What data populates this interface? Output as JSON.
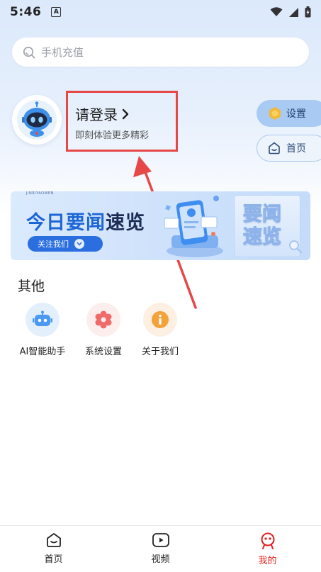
{
  "status_bar": {
    "time": "5:46",
    "notification_icon": "A",
    "icons": [
      "wifi-icon",
      "signal-icon",
      "battery-icon"
    ]
  },
  "search": {
    "placeholder": "手机充值"
  },
  "profile": {
    "login_title": "请登录",
    "login_subtitle": "即刻体验更多精彩",
    "avatar_icon": "robot-avatar-icon"
  },
  "side_buttons": {
    "settings_label": "设置",
    "home_label": "首页"
  },
  "banner": {
    "brand": "JINRIYAOWEN",
    "title_part1": "今日要闻",
    "title_part2": "速览",
    "button_label": "关注我们",
    "card_line1": "要闻",
    "card_line2": "速览"
  },
  "other_section": {
    "title": "其他",
    "tools": [
      {
        "label": "AI智能助手",
        "icon": "robot-icon",
        "color": "#e3f0fc"
      },
      {
        "label": "系统设置",
        "icon": "gear-icon",
        "color": "#fdeeee"
      },
      {
        "label": "关于我们",
        "icon": "info-icon",
        "color": "#fdf0e3"
      }
    ]
  },
  "bottom_nav": {
    "items": [
      {
        "label": "首页",
        "icon": "home-icon"
      },
      {
        "label": "视频",
        "icon": "video-icon"
      },
      {
        "label": "我的",
        "icon": "profile-icon",
        "active": true
      }
    ]
  },
  "colors": {
    "accent_blue": "#2a6ee0",
    "highlight_red": "#e64848",
    "active_nav_red": "#e51e1e"
  }
}
